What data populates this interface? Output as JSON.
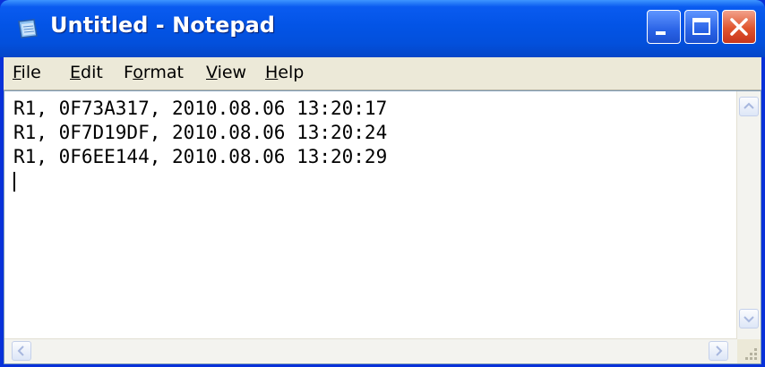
{
  "window": {
    "title": "Untitled - Notepad"
  },
  "menubar": {
    "items": [
      {
        "label": "File",
        "accel": "F",
        "rest": "ile"
      },
      {
        "label": "Edit",
        "accel": "E",
        "rest": "dit"
      },
      {
        "label": "Format",
        "pre": "F",
        "accel": "o",
        "rest": "rmat"
      },
      {
        "label": "View",
        "accel": "V",
        "rest": "iew"
      },
      {
        "label": "Help",
        "accel": "H",
        "rest": "elp"
      }
    ]
  },
  "editor": {
    "lines": [
      "R1, 0F73A317, 2010.08.06 13:20:17",
      "R1, 0F7D19DF, 2010.08.06 13:20:24",
      "R1, 0F6EE144, 2010.08.06 13:20:29"
    ]
  },
  "icons": {
    "app": "notepad-icon",
    "minimize": "minimize-icon",
    "maximize": "maximize-icon",
    "close": "close-icon",
    "scroll_up": "arrow-up-icon",
    "scroll_down": "arrow-down-icon",
    "scroll_left": "arrow-left-icon",
    "scroll_right": "arrow-right-icon",
    "size_grip": "size-grip-icon"
  },
  "colors": {
    "titlebar": "#0354e6",
    "close_button": "#e0552e",
    "menubar": "#ece9d8"
  }
}
